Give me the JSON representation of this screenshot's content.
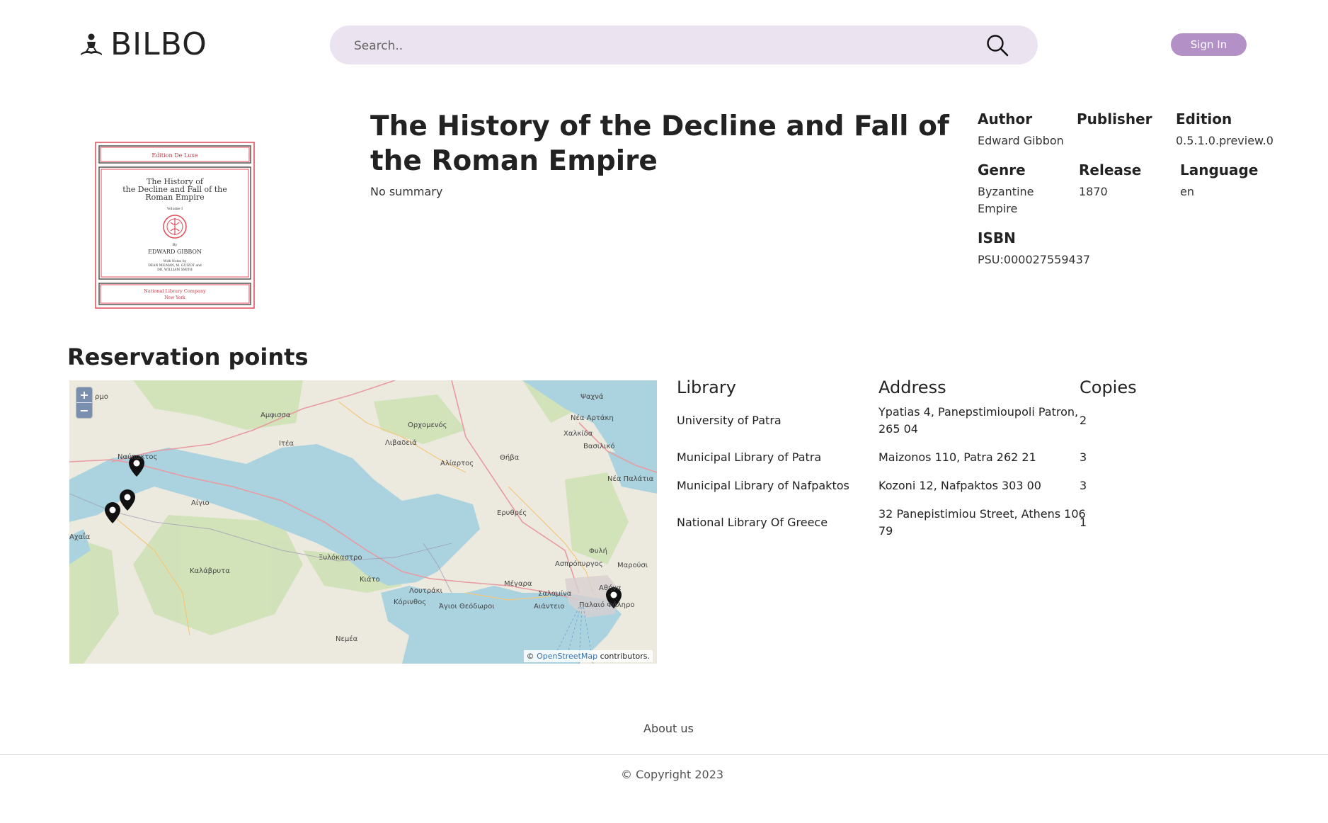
{
  "header": {
    "logo_text": "BILBO",
    "search_placeholder": "Search..",
    "signin_label": "Sign In"
  },
  "book": {
    "title": "The History of the Decline and Fall of the Roman Empire",
    "summary": "No summary",
    "cover": {
      "top_label": "Edition De Luxe",
      "title_lines": [
        "The History of",
        "the Decline and Fall of the",
        "Roman Empire"
      ],
      "volume": "Volume I",
      "by": "By",
      "author": "EDWARD GIBBON",
      "notes_lines": [
        "With Notes by",
        "DEAN MILMAN, M. GUIZOT and",
        "DR. WILLIAM SMITH"
      ],
      "publisher_lines": [
        "National Library Company",
        "New York"
      ]
    },
    "meta": {
      "author_label": "Author",
      "author": "Edward Gibbon",
      "publisher_label": "Publisher",
      "publisher": "",
      "edition_label": "Edition",
      "edition": "0.5.1.0.preview.0",
      "genre_label": "Genre",
      "genre_line1": "Byzantine",
      "genre_line2": "Empire",
      "release_label": "Release",
      "release": "1870",
      "language_label": "Language",
      "language": "en",
      "isbn_label": "ISBN",
      "isbn": "PSU:000027559437"
    }
  },
  "reservation": {
    "title": "Reservation points",
    "map": {
      "zoom_in": "+",
      "zoom_out": "−",
      "attribution_prefix": "©",
      "attribution_link": "OpenStreetMap",
      "attribution_suffix": "contributors.",
      "places": [
        "ρμο",
        "Αμφισσα",
        "Ιτέα",
        "Λιβαδειά",
        "Ορχομενός",
        "Ψαχνά",
        "Νέα Αρτάκη",
        "Χαλκίδα",
        "Βασιλικό",
        "Αλίαρτος",
        "Θήβα",
        "Νέα Παλάτια",
        "Ναύπακτος",
        "Αίγιο",
        "Ερυθρές",
        "Αχαΐα",
        "Καλάβρυτα",
        "Ξυλόκαστρο",
        "Κιάτο",
        "Λουτράκι",
        "Κόρινθος",
        "Άγιοι Θεόδωροι",
        "Μέγαρα",
        "Ασπρόπυργος",
        "Μαρούσι",
        "Φυλή",
        "Σαλαμίνα",
        "Αιάντειο",
        "Αθήνα",
        "Παλαιό Φάληρο",
        "Νεμέα"
      ]
    },
    "table": {
      "headers": [
        "Library",
        "Address",
        "Copies"
      ],
      "rows": [
        {
          "library": "University of Patra",
          "address_line1": "Ypatias 4, Panepstimioupoli Patron,",
          "address_line2": "265 04",
          "copies": "2"
        },
        {
          "library": "Municipal Library of Patra",
          "address_line1": "Maizonos 110, Patra 262 21",
          "address_line2": "",
          "copies": "3"
        },
        {
          "library": "Municipal Library of Nafpaktos",
          "address_line1": "Kozoni 12, Nafpaktos 303 00",
          "address_line2": "",
          "copies": "3"
        },
        {
          "library": "National Library Of Greece",
          "address_line1": "32 Panepistimiou Street, Athens 106",
          "address_line2": "79",
          "copies": "1"
        }
      ]
    }
  },
  "footer": {
    "about": "About us",
    "copyright": "© Copyright 2023"
  },
  "colors": {
    "search_bg": "#ebe3f0",
    "signin_bg": "#b391c6",
    "sea": "#aad3df",
    "land": "#eceadf",
    "forest": "#cfe2b6"
  }
}
